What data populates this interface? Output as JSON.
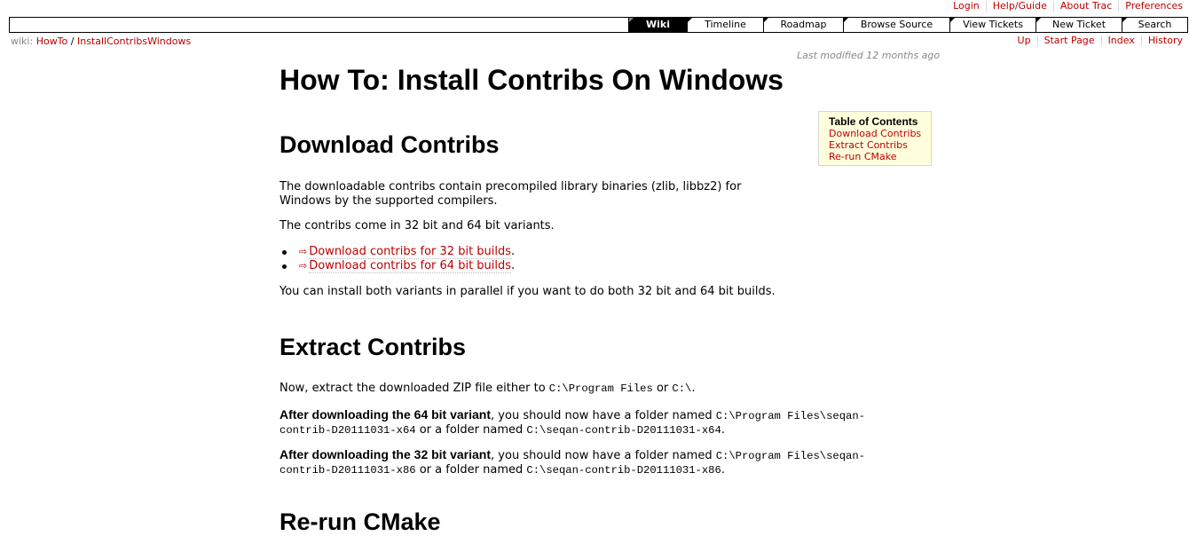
{
  "metanav": [
    "Login",
    "Help/Guide",
    "About Trac",
    "Preferences"
  ],
  "mainnav": [
    "Wiki",
    "Timeline",
    "Roadmap",
    "Browse Source",
    "View Tickets",
    "New Ticket",
    "Search"
  ],
  "breadcrumb": {
    "prefix": "wiki:",
    "part1": "HowTo",
    "sep": "/",
    "part2": "InstallContribsWindows"
  },
  "ctxtnav": [
    "Up",
    "Start Page",
    "Index",
    "History"
  ],
  "last_modified": {
    "label": "Last modified",
    "age": "12 months ago"
  },
  "title": "How To: Install Contribs On Windows",
  "toc": {
    "title": "Table of Contents",
    "items": [
      "Download Contribs",
      "Extract Contribs",
      "Re-run CMake"
    ]
  },
  "sections": {
    "download": {
      "heading": "Download Contribs",
      "p1": "The downloadable contribs contain precompiled library binaries (zlib, libbz2) for Windows by the supported compilers.",
      "p2": "The contribs come in 32 bit and 64 bit variants.",
      "links": [
        "Download contribs for 32 bit builds",
        "Download contribs for 64 bit builds"
      ],
      "p3": "You can install both variants in parallel if you want to do both 32 bit and 64 bit builds."
    },
    "extract": {
      "heading": "Extract Contribs",
      "p1_pre": "Now, extract the downloaded ZIP file either to ",
      "p1_code1": "C:\\Program Files",
      "p1_mid": " or ",
      "p1_code2": "C:\\",
      "p1_end": ".",
      "p2_bold": "After downloading the 64 bit variant",
      "p2_text": ", you should now have a folder named ",
      "p2_code1a": "C:\\Program Files\\seqan-",
      "p2_code1b": "contrib-D20111031-x64",
      "p2_mid": " or a folder named ",
      "p2_code2": "C:\\seqan-contrib-D20111031-x64",
      "p3_bold": "After downloading the 32 bit variant",
      "p3_text": ", you should now have a folder named ",
      "p3_code1a": "C:\\Program Files\\seqan-",
      "p3_code1b": "contrib-D20111031-x86",
      "p3_mid": " or a folder named ",
      "p3_code2": "C:\\seqan-contrib-D20111031-x86",
      "period": "."
    },
    "rerun": {
      "heading": "Re-run CMake"
    }
  }
}
